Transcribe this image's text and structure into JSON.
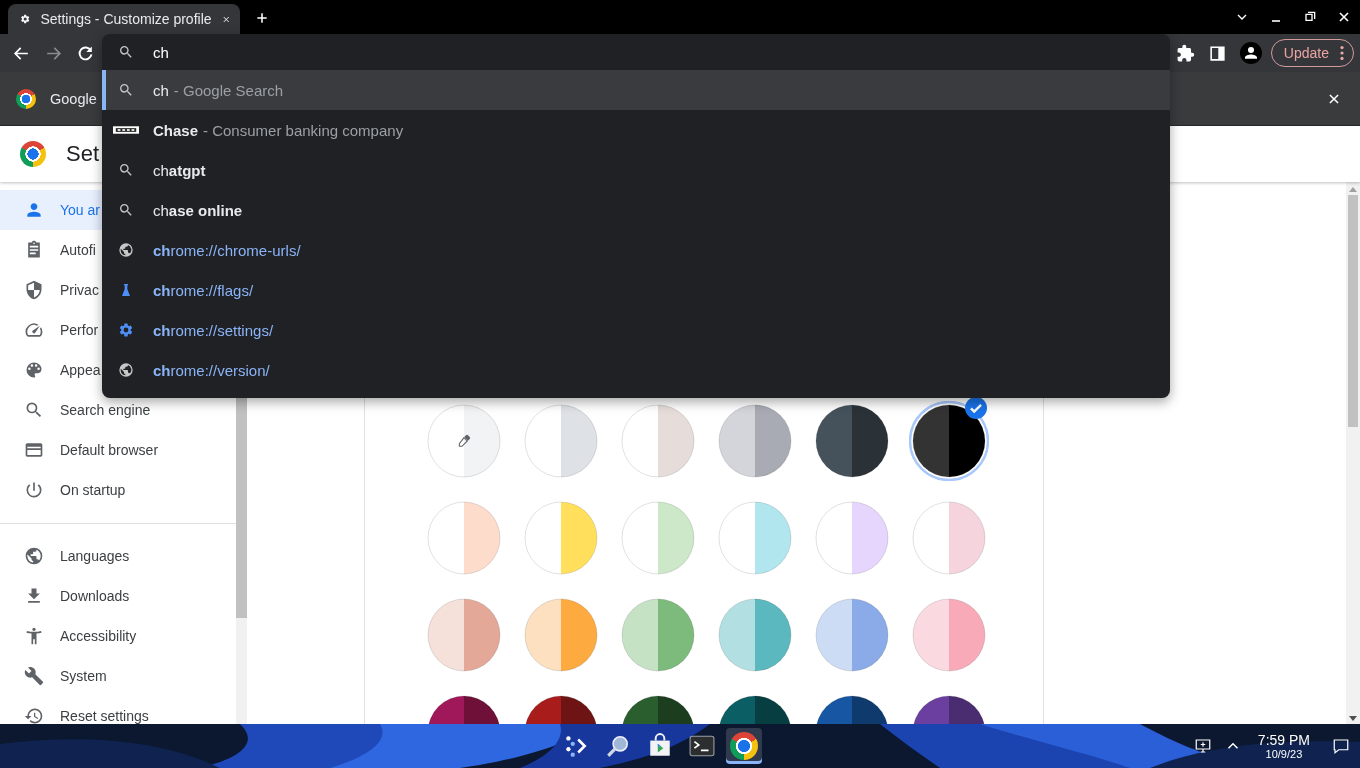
{
  "tab": {
    "title": "Settings - Customize profile"
  },
  "omnibox": {
    "value": "ch"
  },
  "suggestions": [
    {
      "kind": "search",
      "text": "ch",
      "description": "- Google Search",
      "selected": true
    },
    {
      "kind": "entity",
      "text": "**Chase**",
      "description": "- Consumer banking company",
      "selected": false
    },
    {
      "kind": "search",
      "text": "ch**atgpt**",
      "selected": false
    },
    {
      "kind": "search",
      "text": "ch**ase online**",
      "selected": false
    },
    {
      "kind": "page",
      "text": "**ch**rome://chrome-urls/",
      "selected": false
    },
    {
      "kind": "flags",
      "text": "**ch**rome://flags/",
      "selected": false
    },
    {
      "kind": "settings",
      "text": "**ch**rome://settings/",
      "selected": false
    },
    {
      "kind": "page",
      "text": "**ch**rome://version/",
      "selected": false
    }
  ],
  "toolbar": {
    "update_label": "Update"
  },
  "infobar": {
    "text": "Google"
  },
  "settings": {
    "title": "Set"
  },
  "sidebar": {
    "sections": [
      {
        "items": [
          {
            "kind": "person",
            "label": "You ar",
            "selected": true
          },
          {
            "kind": "clipboard",
            "label": "Autofi",
            "selected": false
          },
          {
            "kind": "shield",
            "label": "Privac",
            "selected": false
          },
          {
            "kind": "gauge",
            "label": "Perfor",
            "selected": false
          },
          {
            "kind": "palette",
            "label": "Appea",
            "selected": false
          },
          {
            "kind": "search",
            "label": "Search engine",
            "selected": false
          },
          {
            "kind": "browser",
            "label": "Default browser",
            "selected": false
          },
          {
            "kind": "power",
            "label": "On startup",
            "selected": false
          }
        ]
      },
      {
        "items": [
          {
            "kind": "globe",
            "label": "Languages",
            "selected": false
          },
          {
            "kind": "download",
            "label": "Downloads",
            "selected": false
          },
          {
            "kind": "accessibility",
            "label": "Accessibility",
            "selected": false
          },
          {
            "kind": "wrench",
            "label": "System",
            "selected": false
          },
          {
            "kind": "history",
            "label": "Reset settings",
            "selected": false
          }
        ]
      }
    ]
  },
  "palette": {
    "swatches": [
      {
        "kind": "custom",
        "halves": [
          {
            "color": "#ffffff"
          },
          {
            "color": "#f1f3f4"
          }
        ],
        "selected": false
      },
      {
        "kind": "preset",
        "halves": [
          {
            "color": "#ffffff"
          },
          {
            "color": "#dee1e6"
          }
        ],
        "selected": false
      },
      {
        "kind": "preset",
        "halves": [
          {
            "color": "#ffffff"
          },
          {
            "color": "#e6dcd9"
          }
        ],
        "selected": false
      },
      {
        "kind": "preset",
        "halves": [
          {
            "color": "#d3d5da"
          },
          {
            "color": "#a8abb3"
          }
        ],
        "selected": false
      },
      {
        "kind": "preset",
        "halves": [
          {
            "color": "#45525c"
          },
          {
            "color": "#2b3237"
          }
        ],
        "selected": false
      },
      {
        "kind": "preset",
        "halves": [
          {
            "color": "#333333"
          },
          {
            "color": "#000000"
          }
        ],
        "selected": true
      },
      {
        "kind": "preset",
        "halves": [
          {
            "color": "#ffffff"
          },
          {
            "color": "#fddccb"
          }
        ],
        "selected": false
      },
      {
        "kind": "preset",
        "halves": [
          {
            "color": "#ffffff"
          },
          {
            "color": "#ffdf5c"
          }
        ],
        "selected": false
      },
      {
        "kind": "preset",
        "halves": [
          {
            "color": "#ffffff"
          },
          {
            "color": "#cde8c8"
          }
        ],
        "selected": false
      },
      {
        "kind": "preset",
        "halves": [
          {
            "color": "#ffffff"
          },
          {
            "color": "#b2e6ee"
          }
        ],
        "selected": false
      },
      {
        "kind": "preset",
        "halves": [
          {
            "color": "#ffffff"
          },
          {
            "color": "#e6d5fc"
          }
        ],
        "selected": false
      },
      {
        "kind": "preset",
        "halves": [
          {
            "color": "#ffffff"
          },
          {
            "color": "#f5d4de"
          }
        ],
        "selected": false
      },
      {
        "kind": "preset",
        "halves": [
          {
            "color": "#f6e0da"
          },
          {
            "color": "#e3a898"
          }
        ],
        "selected": false
      },
      {
        "kind": "preset",
        "halves": [
          {
            "color": "#fde0bf"
          },
          {
            "color": "#fdaa40"
          }
        ],
        "selected": false
      },
      {
        "kind": "preset",
        "halves": [
          {
            "color": "#c6e2c5"
          },
          {
            "color": "#7cbb7c"
          }
        ],
        "selected": false
      },
      {
        "kind": "preset",
        "halves": [
          {
            "color": "#b2e0e2"
          },
          {
            "color": "#5bb8bf"
          }
        ],
        "selected": false
      },
      {
        "kind": "preset",
        "halves": [
          {
            "color": "#cddcf5"
          },
          {
            "color": "#8aaae8"
          }
        ],
        "selected": false
      },
      {
        "kind": "preset",
        "halves": [
          {
            "color": "#fadae0"
          },
          {
            "color": "#f9aab8"
          }
        ],
        "selected": false
      },
      {
        "kind": "preset",
        "halves": [
          {
            "color": "#a0175a"
          },
          {
            "color": "#6e1038"
          }
        ],
        "selected": false
      },
      {
        "kind": "preset",
        "halves": [
          {
            "color": "#a81c1c"
          },
          {
            "color": "#6e1414"
          }
        ],
        "selected": false
      },
      {
        "kind": "preset",
        "halves": [
          {
            "color": "#2a5e2e"
          },
          {
            "color": "#1c3d1e"
          }
        ],
        "selected": false
      },
      {
        "kind": "preset",
        "halves": [
          {
            "color": "#0b5e63"
          },
          {
            "color": "#073e41"
          }
        ],
        "selected": false
      },
      {
        "kind": "preset",
        "halves": [
          {
            "color": "#1656a3"
          },
          {
            "color": "#0f3a6e"
          }
        ],
        "selected": false
      },
      {
        "kind": "preset",
        "halves": [
          {
            "color": "#6b3fa0"
          },
          {
            "color": "#4a2c70"
          }
        ],
        "selected": false
      }
    ]
  },
  "taskbar": {
    "apps": [
      {
        "kind": "launcher",
        "active": false
      },
      {
        "kind": "magnifier",
        "active": false
      },
      {
        "kind": "store",
        "active": false
      },
      {
        "kind": "terminal",
        "active": false
      },
      {
        "kind": "browser",
        "active": true
      }
    ],
    "time": "7:59 PM",
    "date": "10/9/23"
  }
}
